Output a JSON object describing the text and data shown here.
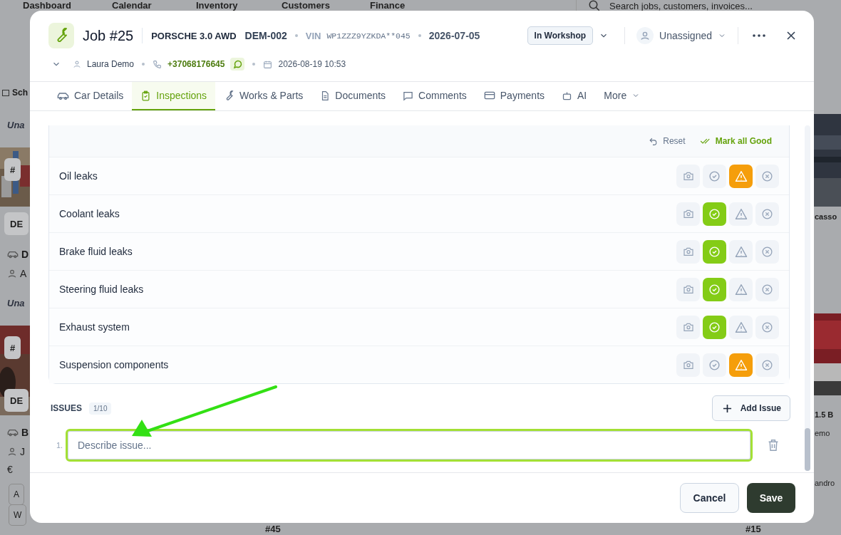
{
  "background": {
    "nav": [
      {
        "label": "Dashboard"
      },
      {
        "label": "Calendar"
      },
      {
        "label": "Inventory"
      },
      {
        "label": "Customers"
      },
      {
        "label": "Finance"
      }
    ],
    "search": {
      "placeholder": "Search jobs, customers, invoices..."
    },
    "left_column": [
      {
        "kind": "heading",
        "text": "Sch"
      },
      {
        "kind": "italic",
        "text": "Una"
      },
      {
        "kind": "chip",
        "text": "#"
      },
      {
        "kind": "chip",
        "text": "DE"
      },
      {
        "kind": "car",
        "text": "D"
      },
      {
        "kind": "person",
        "text": "A"
      },
      {
        "kind": "italic",
        "text": "Una"
      },
      {
        "kind": "chip",
        "text": "#"
      },
      {
        "kind": "chip",
        "text": "DE"
      },
      {
        "kind": "car",
        "text": "B"
      },
      {
        "kind": "person",
        "text": "J"
      },
      {
        "kind": "money",
        "text": "€"
      },
      {
        "kind": "tag",
        "text": "A"
      },
      {
        "kind": "tag",
        "text": "W"
      }
    ],
    "right_column": [
      {
        "kind": "title",
        "text": "casso"
      },
      {
        "kind": "title",
        "text": "1.5 B"
      },
      {
        "kind": "line",
        "text": "emo"
      },
      {
        "kind": "line",
        "text": "andro"
      }
    ],
    "bottom_labels": [
      "#45",
      "#15"
    ]
  },
  "job": {
    "title": "Job #25",
    "vehicle": "PORSCHE 3.0 AWD",
    "plate": "DEM-002",
    "vin_label": "VIN",
    "vin": "WP1ZZZ9YZKDA**045",
    "date": "2026-07-05",
    "status": "In Workshop",
    "assignee": "Unassigned",
    "customer": "Laura Demo",
    "phone": "+37068176645",
    "appointment": "2026-08-19 10:53"
  },
  "tabs": [
    {
      "label": "Car Details",
      "selected": false
    },
    {
      "label": "Inspections",
      "selected": true
    },
    {
      "label": "Works & Parts",
      "selected": false
    },
    {
      "label": "Documents",
      "selected": false
    },
    {
      "label": "Comments",
      "selected": false
    },
    {
      "label": "Payments",
      "selected": false
    },
    {
      "label": "AI",
      "selected": false
    },
    {
      "label": "More",
      "selected": false
    }
  ],
  "inspection": {
    "reset": "Reset",
    "mark_all": "Mark all Good",
    "items": [
      {
        "name": "Oil leaks",
        "good": false,
        "warning": true
      },
      {
        "name": "Coolant leaks",
        "good": true,
        "warning": false
      },
      {
        "name": "Brake fluid leaks",
        "good": true,
        "warning": false
      },
      {
        "name": "Steering fluid leaks",
        "good": true,
        "warning": false
      },
      {
        "name": "Exhaust system",
        "good": true,
        "warning": false
      },
      {
        "name": "Suspension components",
        "good": false,
        "warning": true
      }
    ]
  },
  "issues": {
    "title": "ISSUES",
    "count": "1/10",
    "add_button": "Add Issue",
    "items": [
      {
        "number": "1.",
        "placeholder": "Describe issue...",
        "focused": true
      }
    ]
  },
  "footer": {
    "buttons": [
      {
        "label": "Cancel",
        "kind": "secondary"
      },
      {
        "label": "Save",
        "kind": "primary"
      }
    ]
  }
}
